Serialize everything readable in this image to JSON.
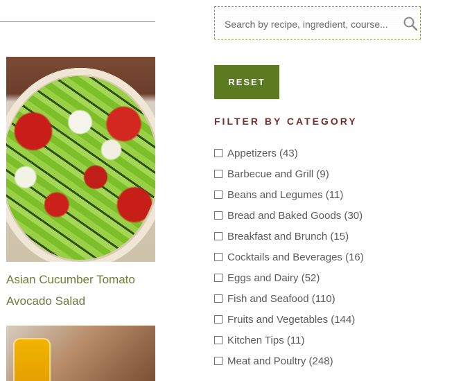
{
  "search": {
    "placeholder": "Search by recipe, ingredient, course..."
  },
  "actions": {
    "reset_label": "RESET"
  },
  "filters": {
    "heading": "FILTER BY CATEGORY",
    "categories": [
      {
        "label": "Appetizers (43)"
      },
      {
        "label": "Barbecue and Grill (9)"
      },
      {
        "label": "Beans and Legumes (11)"
      },
      {
        "label": "Bread and Baked Goods (30)"
      },
      {
        "label": "Breakfast and Brunch (15)"
      },
      {
        "label": "Cocktails and Beverages (16)"
      },
      {
        "label": "Eggs and Dairy (52)"
      },
      {
        "label": "Fish and Seafood (110)"
      },
      {
        "label": "Fruits and Vegetables (144)"
      },
      {
        "label": "Kitchen Tips (11)"
      },
      {
        "label": "Meat and Poultry (248)"
      }
    ]
  },
  "recipes": [
    {
      "title_line_1": "Asian Cucumber Tomato",
      "title_line_2": "Avocado Salad"
    }
  ],
  "colors": {
    "accent_green": "#5c7a1f",
    "title_green": "#6f7b3a",
    "heading_maroon": "#7a2e2a"
  }
}
